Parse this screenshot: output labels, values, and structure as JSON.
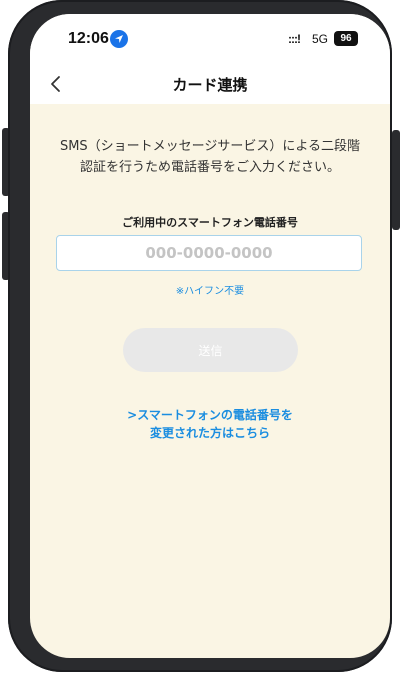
{
  "status_bar": {
    "time": "12:06",
    "signal": ":::!",
    "network": "5G",
    "battery": "96"
  },
  "nav": {
    "title": "カード連携"
  },
  "content": {
    "instruction_line1": "SMS（ショートメッセージサービス）による二段階",
    "instruction_line2": "認証を行うため電話番号をご入力ください。",
    "field_label": "ご利用中のスマートフォン電話番号",
    "phone_placeholder": "000-0000-0000",
    "phone_value": "",
    "hint": "※ハイフン不要",
    "send_label": "送信",
    "change_link_line1": ">スマートフォンの電話番号を",
    "change_link_line2": "変更された方はこちら"
  },
  "colors": {
    "background": "#faf5e4",
    "accent": "#1a8de0",
    "button_disabled": "#e8e8e8"
  },
  "icons": {
    "location": "location-arrow-icon",
    "back": "chevron-left-icon"
  }
}
